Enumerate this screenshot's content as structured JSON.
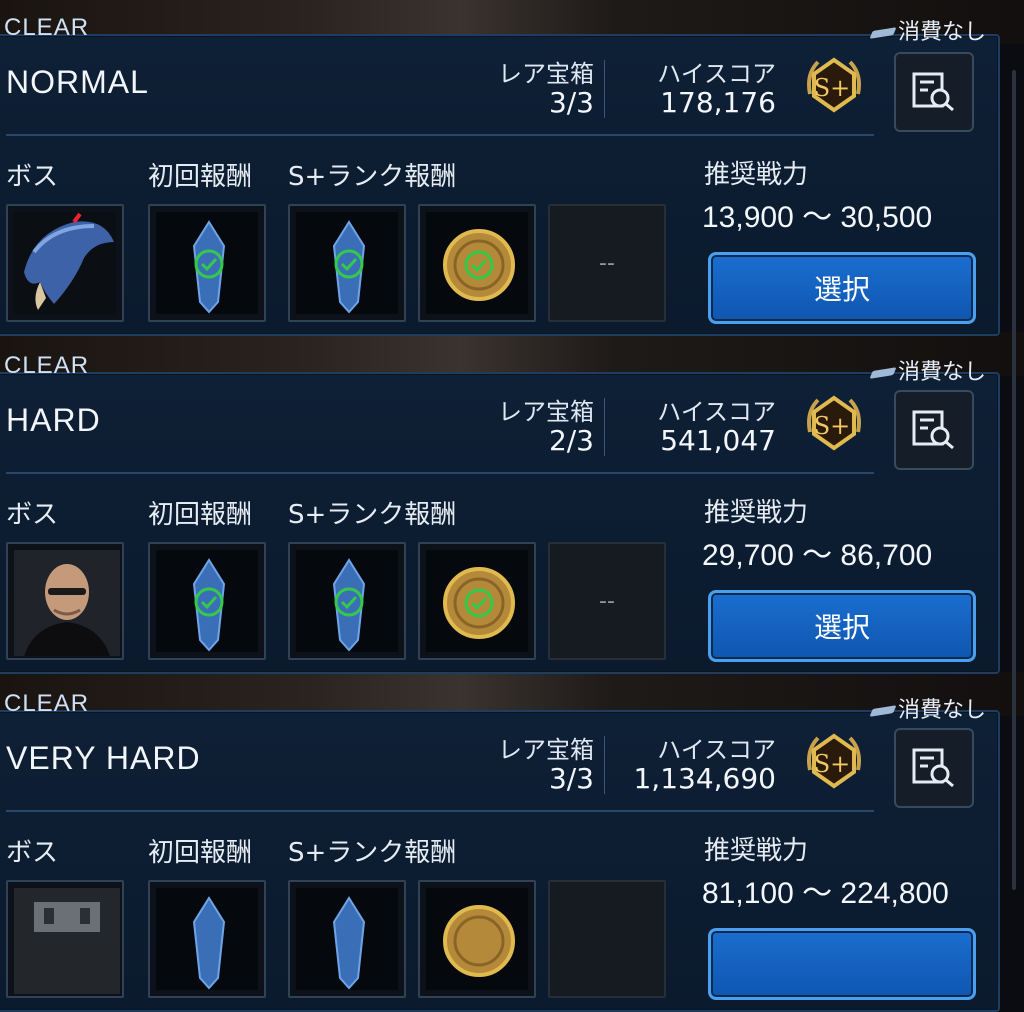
{
  "cost_label": "消費なし",
  "labels": {
    "rare_chest": "レア宝箱",
    "high_score": "ハイスコア",
    "boss": "ボス",
    "first_reward": "初回報酬",
    "srank_reward": "S+ランク報酬",
    "recommended_power": "推奨戦力",
    "select": "選択",
    "empty_slot": "--"
  },
  "difficulties": [
    {
      "clear": "CLEAR",
      "name": "NORMAL",
      "rare_chest": "3/3",
      "high_score": "178,176",
      "recommended_power": "13,900 ～ 30,500",
      "boss_icon": "blue-bird-boss-icon"
    },
    {
      "clear": "CLEAR",
      "name": "HARD",
      "rare_chest": "2/3",
      "high_score": "541,047",
      "recommended_power": "29,700 ～ 86,700",
      "boss_icon": "bald-man-boss-icon"
    },
    {
      "clear": "CLEAR",
      "name": "VERY HARD",
      "rare_chest": "3/3",
      "high_score": "1,134,690",
      "recommended_power": "81,100 ～ 224,800",
      "boss_icon": "robot-boss-icon"
    }
  ],
  "rank": "S+",
  "colors": {
    "accent": "#1a6ed0",
    "panel": "#0e2036",
    "gold": "#c9a24a",
    "check": "#35c94a"
  }
}
